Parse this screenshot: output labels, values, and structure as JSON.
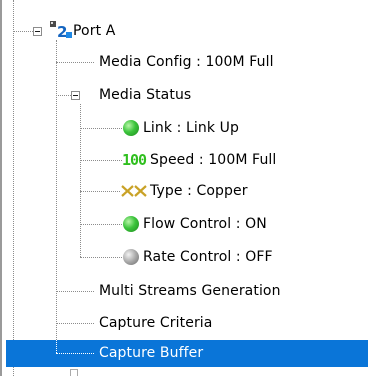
{
  "tree": {
    "port": {
      "label": "Port A",
      "icon": "port-icon"
    },
    "media_config": {
      "label": "Media Config : 100M Full"
    },
    "media_status": {
      "label": "Media Status",
      "children": {
        "link": {
          "label": "Link : Link Up",
          "icon": "green-status-icon"
        },
        "speed": {
          "label": "Speed : 100M Full",
          "icon_text": "100"
        },
        "type": {
          "label": "Type : Copper",
          "icon": "copper-icon"
        },
        "flow_control": {
          "label": "Flow Control : ON",
          "icon": "green-status-icon"
        },
        "rate_control": {
          "label": "Rate Control : OFF",
          "icon": "grey-status-icon"
        }
      }
    },
    "multi_streams": {
      "label": "Multi Streams Generation"
    },
    "capture_criteria": {
      "label": "Capture Criteria"
    },
    "capture_buffer": {
      "label": "Capture Buffer",
      "selected": true
    }
  },
  "colors": {
    "selection": "#0a75d8",
    "speed_icon": "#2fbf1e",
    "type_icon": "#c9a227"
  }
}
